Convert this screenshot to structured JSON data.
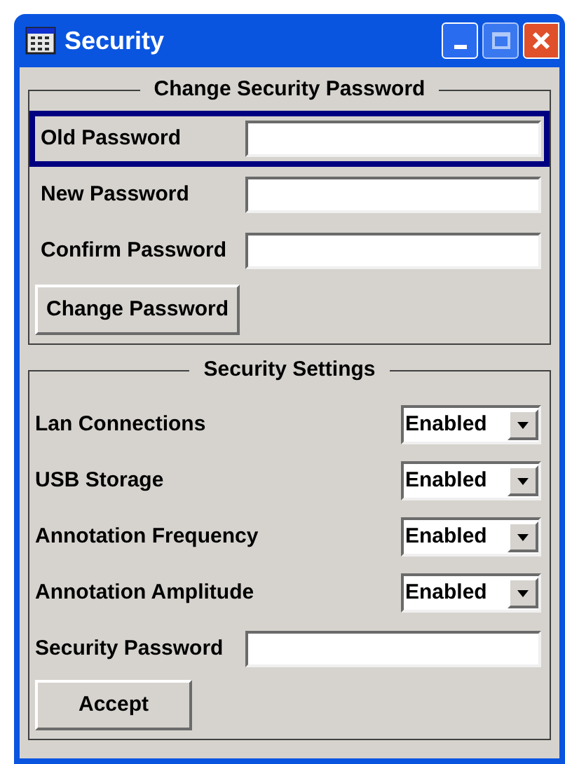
{
  "window": {
    "title": "Security"
  },
  "change_password": {
    "title": "Change Security Password",
    "fields": [
      {
        "label": "Old Password",
        "focused": true
      },
      {
        "label": "New Password",
        "focused": false
      },
      {
        "label": "Confirm Password",
        "focused": false
      }
    ],
    "button": "Change Password"
  },
  "security_settings": {
    "title": "Security Settings",
    "rows": [
      {
        "kind": "select",
        "label": "Lan Connections",
        "value": "Enabled"
      },
      {
        "kind": "select",
        "label": "USB Storage",
        "value": "Enabled"
      },
      {
        "kind": "select",
        "label": "Annotation Frequency",
        "value": "Enabled"
      },
      {
        "kind": "select",
        "label": "Annotation Amplitude",
        "value": "Enabled"
      },
      {
        "kind": "field",
        "label": "Security Password"
      }
    ],
    "button": "Accept"
  }
}
